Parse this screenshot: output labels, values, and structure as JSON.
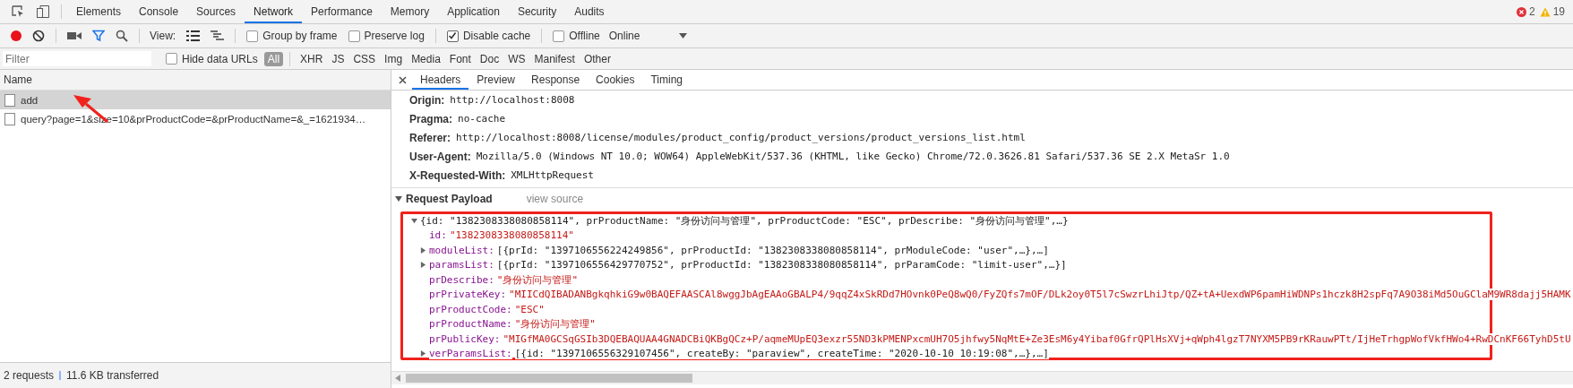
{
  "panel_tabs": [
    {
      "label": "Elements",
      "selected": false
    },
    {
      "label": "Console",
      "selected": false
    },
    {
      "label": "Sources",
      "selected": false
    },
    {
      "label": "Network",
      "selected": true
    },
    {
      "label": "Performance",
      "selected": false
    },
    {
      "label": "Memory",
      "selected": false
    },
    {
      "label": "Application",
      "selected": false
    },
    {
      "label": "Security",
      "selected": false
    },
    {
      "label": "Audits",
      "selected": false
    }
  ],
  "counters": {
    "errors": "2",
    "warnings": "19"
  },
  "toolbar": {
    "recording": true,
    "filter_on": true,
    "view_label": "View:",
    "checkboxes": [
      {
        "label": "Group by frame",
        "checked": false
      },
      {
        "label": "Preserve log",
        "checked": false
      },
      {
        "label": "Disable cache",
        "checked": true
      },
      {
        "label": "Offline",
        "checked": false
      }
    ],
    "throttling": "Online"
  },
  "filter_bar": {
    "placeholder": "Filter",
    "hide_data_urls": {
      "label": "Hide data URLs",
      "checked": false
    },
    "types": [
      {
        "label": "All",
        "selected": true
      },
      {
        "label": "XHR",
        "selected": false
      },
      {
        "label": "JS",
        "selected": false
      },
      {
        "label": "CSS",
        "selected": false
      },
      {
        "label": "Img",
        "selected": false
      },
      {
        "label": "Media",
        "selected": false
      },
      {
        "label": "Font",
        "selected": false
      },
      {
        "label": "Doc",
        "selected": false
      },
      {
        "label": "WS",
        "selected": false
      },
      {
        "label": "Manifest",
        "selected": false
      },
      {
        "label": "Other",
        "selected": false
      }
    ]
  },
  "requests": {
    "column": "Name",
    "rows": [
      {
        "name": "add",
        "selected": true
      },
      {
        "name": "query?page=1&size=10&prProductCode=&prProductName=&_=1621934…",
        "selected": false
      }
    ]
  },
  "status_bar": {
    "requests": "2 requests",
    "transferred": "11.6 KB transferred"
  },
  "detail_tabs": [
    {
      "label": "Headers",
      "selected": true
    },
    {
      "label": "Preview",
      "selected": false
    },
    {
      "label": "Response",
      "selected": false
    },
    {
      "label": "Cookies",
      "selected": false
    },
    {
      "label": "Timing",
      "selected": false
    }
  ],
  "headers": [
    {
      "name": "Origin:",
      "value": "http://localhost:8008"
    },
    {
      "name": "Pragma:",
      "value": "no-cache"
    },
    {
      "name": "Referer:",
      "value": "http://localhost:8008/license/modules/product_config/product_versions/product_versions_list.html"
    },
    {
      "name": "User-Agent:",
      "value": "Mozilla/5.0 (Windows NT 10.0; WOW64) AppleWebKit/537.36 (KHTML, like Gecko) Chrome/72.0.3626.81 Safari/537.36 SE 2.X MetaSr 1.0"
    },
    {
      "name": "X-Requested-With:",
      "value": "XMLHttpRequest"
    }
  ],
  "payload": {
    "title": "Request Payload",
    "expanded": true,
    "view_source": "view source",
    "lines": [
      {
        "kind": "summary",
        "expanded": true,
        "text": "{id: \"1382308338080858114\", prProductName: \"身份访问与管理\", prProductCode: \"ESC\", prDescribe: \"身份访问与管理\",…}"
      },
      {
        "kind": "string",
        "key": "id:",
        "value": "\"1382308338080858114\""
      },
      {
        "kind": "object",
        "expanded": false,
        "key": "moduleList:",
        "value": "[{prId: \"1397106556224249856\", prProductId: \"1382308338080858114\", prModuleCode: \"user\",…},…]"
      },
      {
        "kind": "object",
        "expanded": false,
        "key": "paramsList:",
        "value": "[{prId: \"1397106556429770752\", prProductId: \"1382308338080858114\", prParamCode: \"limit-user\",…}]"
      },
      {
        "kind": "string",
        "key": "prDescribe:",
        "value": "\"身份访问与管理\""
      },
      {
        "kind": "string",
        "key": "prPrivateKey:",
        "value": "\"MIICdQIBADANBgkqhkiG9w0BAQEFAASCAl8wggJbAgEAAoGBALP4/9qqZ4xSkRDd7HOvnk0PeQ8wQ0/FyZQfs7mOF/DLk2oy0T5l7cSwzrLhiJtp/QZ+tA+UexdWP6pamHiWDNPs1hczk8H2spFq7A9O38iMd5OuGClaM9WR8dajj5HAMK"
      },
      {
        "kind": "string",
        "key": "prProductCode:",
        "value": "\"ESC\""
      },
      {
        "kind": "string",
        "key": "prProductName:",
        "value": "\"身份访问与管理\""
      },
      {
        "kind": "string",
        "key": "prPublicKey:",
        "value": "\"MIGfMA0GCSqGSIb3DQEBAQUAA4GNADCBiQKBgQCz+P/aqmeMUpEQ3exzr55ND3kPMENPxcmUH7O5jhfwy5NqMtE+Ze3EsM6y4Yibaf0GfrQPlHsXVj+qWph4lgzT7NYXM5PB9rKRauwPTt/IjHeTrhgpWofVkfHWo4+RwDCnKF66TyhD5tU"
      },
      {
        "kind": "object",
        "expanded": false,
        "key": "verParamsList:",
        "value": "[{id: \"1397106556329107456\", createBy: \"paraview\", createTime: \"2020-10-10 10:19:08\",…},…]"
      }
    ]
  }
}
